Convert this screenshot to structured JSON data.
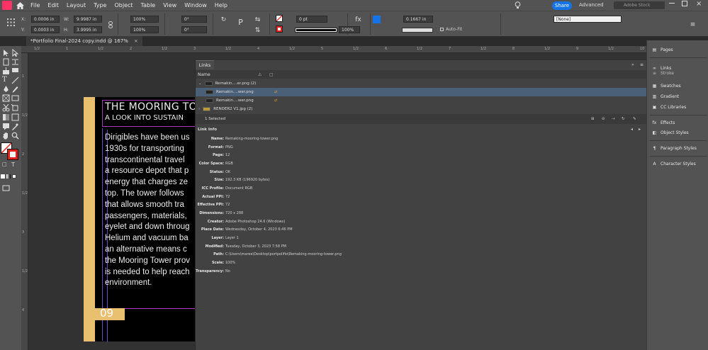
{
  "menubar": {
    "items": [
      "File",
      "Edit",
      "Layout",
      "Type",
      "Object",
      "Table",
      "View",
      "Window",
      "Help"
    ],
    "share_label": "Share",
    "advanced_label": "Advanced",
    "stock_placeholder": "Adobe Stock"
  },
  "control": {
    "x_label": "X:",
    "x_value": "0.0006 in",
    "y_label": "Y:",
    "y_value": "0.0003 in",
    "w_label": "W:",
    "w_value": "9.9987 in",
    "h_label": "H:",
    "h_value": "3.9995 in",
    "scale_x": "100%",
    "scale_y": "100%",
    "angle": "0°",
    "shear": "0°",
    "stroke_weight": "0 pt",
    "opacity": "100%",
    "ref_value": "0.1667 in",
    "autofit_label": "Auto-Fit",
    "style_value": "[None]"
  },
  "document_tab": "*Portfolio Final-2024 copy.indd @ 167%",
  "ruler": {
    "top_ticks": [
      "1/2",
      "1",
      "1/2",
      "2",
      "1/2",
      "3",
      "1/2",
      "4",
      "1/2",
      "5",
      "1/2",
      "6",
      "1/2",
      "7",
      "1/2",
      "8",
      "1/2",
      "9",
      "1/2",
      "10",
      "1/2"
    ],
    "left_ticks": [
      "1",
      "1/2",
      "2",
      "1/2",
      "3",
      "1/2",
      "4"
    ]
  },
  "document": {
    "title": "THE MOORING TOW",
    "subtitle": "A LOOK INTO SUSTAIN",
    "body_lines": [
      "Dirigibles have been us",
      "1930s for transporting",
      "transcontinental travel",
      "a resource depot that p",
      "energy that charges ze",
      "top. The tower follows",
      "that allows smooth tra",
      "passengers, materials,",
      "eyelet and down throug",
      "Helium and vacuum ba",
      "an alternative means c",
      "the Mooring Tower prov",
      "is needed to help reach",
      "environment."
    ],
    "page_number": "09"
  },
  "links_panel": {
    "tab": "Links",
    "column_name": "Name",
    "rows": [
      {
        "name": "Remakin....er.png (2)",
        "selected": false,
        "indent": 0
      },
      {
        "name": "Remakin....wer.png",
        "selected": true,
        "indent": 1
      },
      {
        "name": "Remakin....wer.png",
        "selected": false,
        "indent": 1
      },
      {
        "name": "RENDER2 V1.jpg (2)",
        "selected": false,
        "indent": 0
      }
    ],
    "selected_count": "1 Selected",
    "link_info_title": "Link Info",
    "info": [
      {
        "key": "Name:",
        "value": "Remaking-mooring-tower.png"
      },
      {
        "key": "Format:",
        "value": "PNG"
      },
      {
        "key": "Page:",
        "value": "12"
      },
      {
        "key": "Color Space:",
        "value": "RGB"
      },
      {
        "key": "Status:",
        "value": "OK"
      },
      {
        "key": "Size:",
        "value": "192.3 KB (196920 bytes)"
      },
      {
        "key": "ICC Profile:",
        "value": "Document RGB"
      },
      {
        "key": "Actual PPI:",
        "value": "72"
      },
      {
        "key": "Effective PPI:",
        "value": "72"
      },
      {
        "key": "Dimensions:",
        "value": "720 x 288"
      },
      {
        "key": "Creator:",
        "value": "Adobe Photoshop 24.6 (Windows)"
      },
      {
        "key": "Place Date:",
        "value": "Wednesday, October 4, 2023 6:46 PM"
      },
      {
        "key": "Layer:",
        "value": "Layer 1"
      },
      {
        "key": "Modified:",
        "value": "Tuesday, October 3, 2023 7:58 PM"
      },
      {
        "key": "Path:",
        "value": "C:\\Users\\maree\\Desktop\\portpolifio\\Remaking-mooring-tower.png"
      },
      {
        "key": "Scale:",
        "value": "100%"
      },
      {
        "key": "Transparency:",
        "value": "No"
      }
    ]
  },
  "right_panel": {
    "items": [
      {
        "label": "Pages",
        "icon": "pages-icon"
      },
      {
        "label": "Links",
        "icon": "links-icon"
      },
      {
        "label": "Stroke",
        "icon": "stroke-icon"
      },
      {
        "label": "Swatches",
        "icon": "swatches-icon"
      },
      {
        "label": "Gradient",
        "icon": "gradient-icon"
      },
      {
        "label": "CC Libraries",
        "icon": "cc-libraries-icon"
      },
      {
        "label": "Effects",
        "icon": "effects-icon"
      },
      {
        "label": "Object Styles",
        "icon": "object-styles-icon"
      },
      {
        "label": "Paragraph Styles",
        "icon": "paragraph-styles-icon"
      },
      {
        "label": "Character Styles",
        "icon": "character-styles-icon"
      }
    ]
  },
  "colors": {
    "accent": "#1473e6",
    "gold": "#e8c070",
    "app_logo": "#ff3366",
    "selection": "#4a6078"
  }
}
